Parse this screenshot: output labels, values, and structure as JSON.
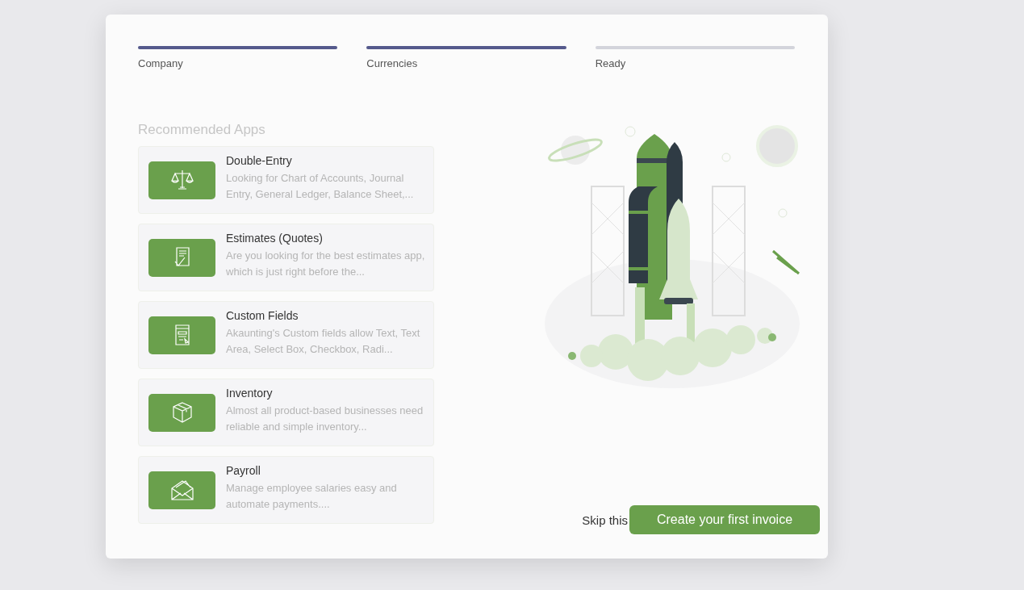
{
  "steps": [
    {
      "label": "Company",
      "done": true
    },
    {
      "label": "Currencies",
      "done": true
    },
    {
      "label": "Ready",
      "done": false
    }
  ],
  "section_title": "Recommended Apps",
  "apps": [
    {
      "kind": "scales",
      "name": "Double-Entry",
      "description": "Looking for Chart of Accounts, Journal Entry, General Ledger, Balance Sheet,..."
    },
    {
      "kind": "document",
      "name": "Estimates (Quotes)",
      "description": "Are you looking for the best estimates app, which is just right before the..."
    },
    {
      "kind": "form",
      "name": "Custom Fields",
      "description": "Akaunting's Custom fields allow Text, Text Area, Select Box, Checkbox, Radi..."
    },
    {
      "kind": "box",
      "name": "Inventory",
      "description": "Almost all product-based businesses need reliable and simple inventory..."
    },
    {
      "kind": "envelope",
      "name": "Payroll",
      "description": "Manage employee salaries easy and automate payments...."
    }
  ],
  "skip_link": "Skip this",
  "primary_button": "Create your first invoice"
}
